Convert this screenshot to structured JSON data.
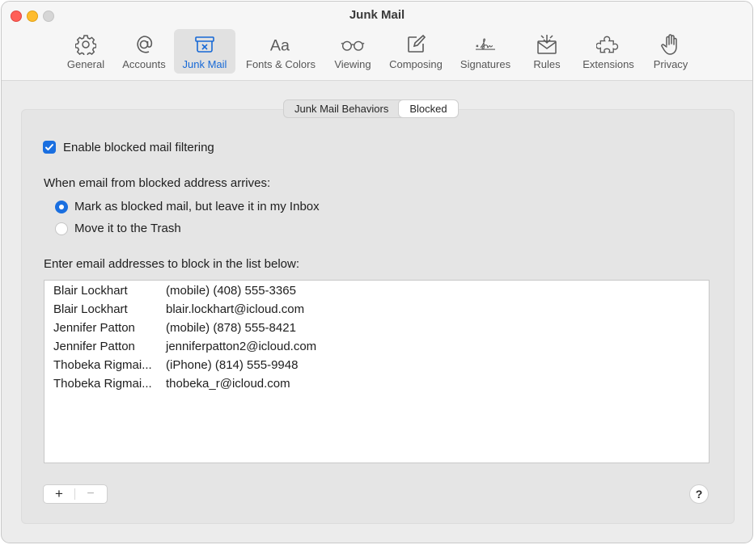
{
  "window": {
    "title": "Junk Mail"
  },
  "toolbar": {
    "items": [
      {
        "label": "General",
        "icon": "gear-icon",
        "active": false
      },
      {
        "label": "Accounts",
        "icon": "at-sign-icon",
        "active": false
      },
      {
        "label": "Junk Mail",
        "icon": "junk-tray-icon",
        "active": true
      },
      {
        "label": "Fonts & Colors",
        "icon": "font-icon",
        "active": false
      },
      {
        "label": "Viewing",
        "icon": "glasses-icon",
        "active": false
      },
      {
        "label": "Composing",
        "icon": "compose-icon",
        "active": false
      },
      {
        "label": "Signatures",
        "icon": "signature-icon",
        "active": false
      },
      {
        "label": "Rules",
        "icon": "rules-envelope-icon",
        "active": false
      },
      {
        "label": "Extensions",
        "icon": "puzzle-icon",
        "active": false
      },
      {
        "label": "Privacy",
        "icon": "hand-icon",
        "active": false
      }
    ],
    "accent_color": "#1769d6"
  },
  "tabs": [
    {
      "label": "Junk Mail Behaviors",
      "selected": false
    },
    {
      "label": "Blocked",
      "selected": true
    }
  ],
  "filtering": {
    "checkbox_label": "Enable blocked mail filtering",
    "checked": true
  },
  "arrival": {
    "heading": "When email from blocked address arrives:",
    "options": [
      {
        "label": "Mark as blocked mail, but leave it in my Inbox",
        "selected": true
      },
      {
        "label": "Move it to the Trash",
        "selected": false
      }
    ]
  },
  "blocklist": {
    "heading": "Enter email addresses to block in the list below:",
    "rows": [
      {
        "name": "Blair Lockhart",
        "address": "(mobile) (408) 555-3365"
      },
      {
        "name": "Blair Lockhart",
        "address": "blair.lockhart@icloud.com"
      },
      {
        "name": "Jennifer Patton",
        "address": "(mobile) (878) 555-8421"
      },
      {
        "name": "Jennifer Patton",
        "address": "jenniferpatton2@icloud.com"
      },
      {
        "name": "Thobeka Rigmai...",
        "address": "(iPhone) (814) 555-9948"
      },
      {
        "name": "Thobeka Rigmai...",
        "address": "thobeka_r@icloud.com"
      }
    ]
  },
  "controls": {
    "add": "+",
    "remove": "−",
    "help": "?"
  }
}
